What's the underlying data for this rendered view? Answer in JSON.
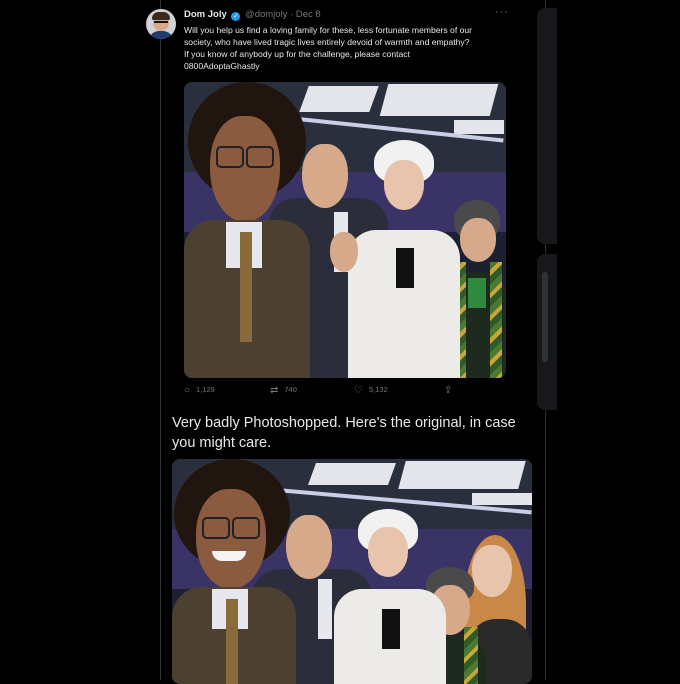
{
  "tweet": {
    "author_name": "Dom Joly",
    "verified_icon": "verified-badge-icon",
    "handle": "@domjoly",
    "separator": "·",
    "date": "Dec 8",
    "more_icon": "···",
    "text_lines": [
      "Will you help us find a loving family for these, less fortunate members of our",
      "society, who have lived tragic lives entirely devoid of warmth and empathy?",
      "If you know of anybody up for the challenge, please contact",
      "0800AdoptaGhastly"
    ],
    "photo_icon": "studio-group-photo-edited",
    "actions": {
      "reply_icon": "comment-icon",
      "reply_count": "1,129",
      "retweet_icon": "retweet-icon",
      "retweet_count": "740",
      "like_icon": "heart-icon",
      "like_count": "5,132",
      "share_icon": "share-icon"
    }
  },
  "reply": {
    "text": "Very badly Photoshopped. Here's the original, in case you might care.",
    "photo_icon": "studio-group-photo-original"
  },
  "colors": {
    "background": "#000000",
    "text": "#e7e9ea",
    "secondary": "#71767b",
    "verified": "#1d9bf0",
    "border": "#2f3336"
  }
}
